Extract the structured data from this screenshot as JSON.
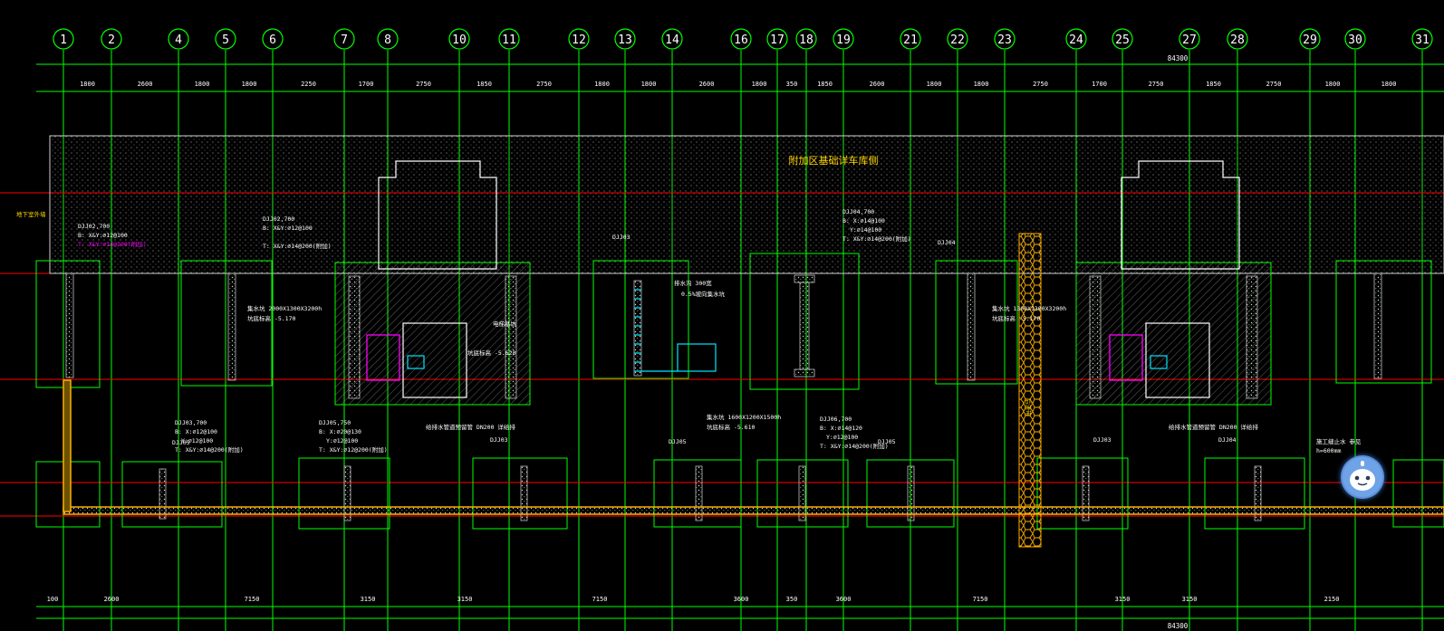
{
  "axis_labels": [
    "1",
    "2",
    "4",
    "5",
    "6",
    "7",
    "8",
    "10",
    "11",
    "12",
    "13",
    "14",
    "16",
    "17",
    "18",
    "19",
    "21",
    "22",
    "23",
    "24",
    "25",
    "27",
    "28",
    "29",
    "30",
    "31"
  ],
  "top_total": "84300",
  "bottom_total": "84300",
  "top_dims": [
    "1800",
    "2600",
    "1800",
    "1800",
    "2250",
    "1700",
    "2750",
    "1850",
    "2750",
    "1800",
    "1800",
    "2600",
    "1800",
    "350",
    "1850",
    "2600",
    "1800",
    "1800",
    "2750",
    "1700",
    "2750",
    "1850",
    "2750",
    "1800",
    "1800"
  ],
  "bottom_dims": [
    "100",
    "2600",
    "7150",
    "3150",
    "3150",
    "7150",
    "3600",
    "350",
    "3600",
    "7150",
    "3150",
    "3150",
    "2150"
  ],
  "band_title": "附加区基础详车库侧",
  "annotations": {
    "yellow_left": "地下室外墙",
    "yellow_vertical": "后浇带",
    "dj02_title": "DJJ02,700",
    "dj02_b": "B: X&Y:⌀12@100",
    "dj02_t": "T: X&Y:⌀14@200(附加)",
    "dj02b_title": "DJJ02,700",
    "dj02b_b": "B: X&Y:⌀12@100",
    "dj02b_t": "T: X&Y:⌀14@200(附加)",
    "dj03_title": "DJJ03,700",
    "dj03_b": "B: X:⌀12@100",
    "dj03_y": "Y:⌀12@100",
    "dj03_t": "T: X&Y:⌀14@200(附加)",
    "dj05_title": "DJJ05,750",
    "dj05_b": "B: X:⌀20@130",
    "dj05_y": "Y:⌀12@100",
    "dj05_t": "T: X&Y:⌀12@200(附加)",
    "dj04_title": "DJJ04,700",
    "dj04_b": "B: X:⌀14@100",
    "dj04_y": "Y:⌀14@100",
    "dj04_t": "T: X&Y:⌀14@200(附加)",
    "dj06_title": "DJJ06,700",
    "dj06_b": "B: X:⌀14@120",
    "dj06_y": "Y:⌀12@100",
    "dj06_t": "T: X&Y:⌀14@200(附加)",
    "sump_left": "集水坑 2000X1300X3200h",
    "sump_left_2": "坑底标高 -5.170",
    "sump_mid": "集水坑 1600X1200X1500h",
    "sump_mid_2": "坑底标高 -5.610",
    "sump_right": "集水坑 1300X1300X3200h",
    "sump_right_2": "坑底标高 -5.170",
    "elev_pit": "电梯基坑",
    "elev_pit_2": "坑底标高 -5.620",
    "ramp": "排水沟 300宽",
    "ramp_2": "0.5%坡向集水坑",
    "pipe_left": "给排水管道预留管 DN200 详给排",
    "pipe_right": "给排水管道预留管 DN200 详给排",
    "note_right_1": "施工缝止水 参见",
    "note_right_2": "h=600mm",
    "dj_labels": [
      "DJJ05",
      "DJJ03",
      "DJJ05",
      "DJJ05",
      "DJJ03",
      "DJJ04",
      "DJJ04",
      "DJJ03"
    ]
  },
  "colors": {
    "background": "#000000",
    "axis_line": "#00ff00",
    "axis_circle": "#00ff00",
    "dim_text": "#ffffff",
    "red_line": "#ff0000",
    "yellow": "#ffd400",
    "orange": "#ffb000",
    "magenta": "#ff00ff",
    "cyan": "#00e5ff",
    "hatch": "#bfbfbf"
  },
  "float_button_icon": "assistant-face-icon"
}
